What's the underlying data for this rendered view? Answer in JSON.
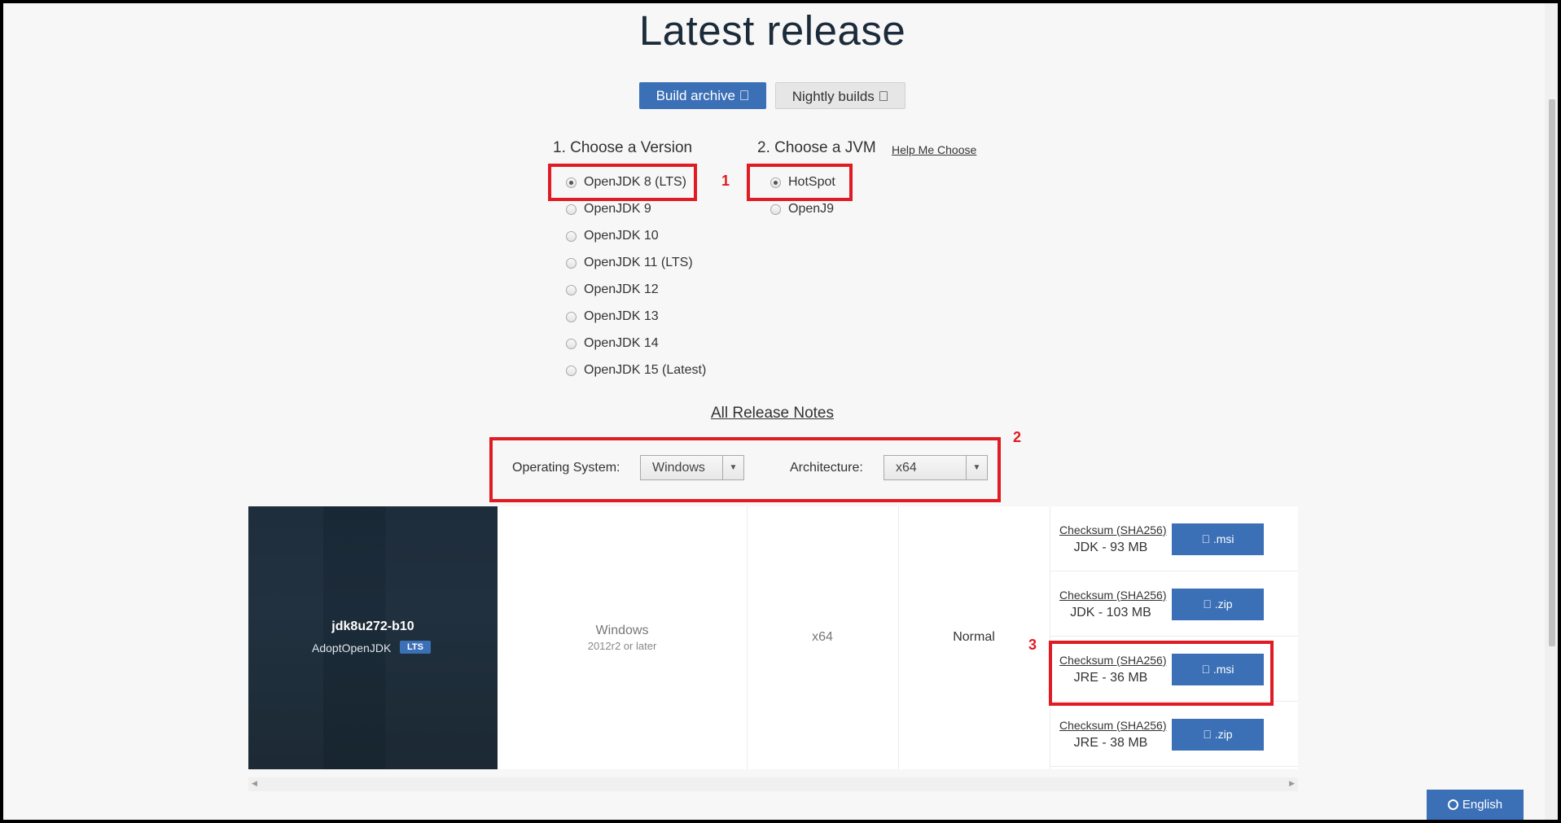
{
  "page": {
    "title": "Latest release"
  },
  "top_buttons": {
    "build_archive": "Build archive ",
    "nightly_builds": "Nightly builds "
  },
  "version": {
    "heading": "1. Choose a Version",
    "options": [
      "OpenJDK 8 (LTS)",
      "OpenJDK 9",
      "OpenJDK 10",
      "OpenJDK 11 (LTS)",
      "OpenJDK 12",
      "OpenJDK 13",
      "OpenJDK 14",
      "OpenJDK 15 (Latest)"
    ],
    "selected": "OpenJDK 8 (LTS)"
  },
  "jvm": {
    "heading": "2. Choose a JVM",
    "help_link": "Help Me Choose",
    "options": [
      "HotSpot",
      "OpenJ9"
    ],
    "selected": "HotSpot"
  },
  "annotations": {
    "n1": "1",
    "n2": "2",
    "n3": "3"
  },
  "release_notes_link": "All Release Notes",
  "filters": {
    "os_label": "Operating System:",
    "os_value": "Windows",
    "arch_label": "Architecture:",
    "arch_value": "x64"
  },
  "release": {
    "name": "jdk8u272-b10",
    "vendor": "AdoptOpenJDK",
    "badge": "LTS",
    "os": "Windows",
    "os_sub": "2012r2 or later",
    "arch": "x64",
    "heap": "Normal",
    "downloads": [
      {
        "checksum": "Checksum (SHA256)",
        "size": "JDK - 93 MB",
        "button": " .msi"
      },
      {
        "checksum": "Checksum (SHA256)",
        "size": "JDK - 103 MB",
        "button": " .zip"
      },
      {
        "checksum": "Checksum (SHA256)",
        "size": "JRE - 36 MB",
        "button": " .msi"
      },
      {
        "checksum": "Checksum (SHA256)",
        "size": "JRE - 38 MB",
        "button": " .zip"
      }
    ]
  },
  "language_button": "English",
  "colors": {
    "accent": "#3b6fb6",
    "annotation_red": "#e01b24",
    "tile_dark": "#1b2a38"
  }
}
